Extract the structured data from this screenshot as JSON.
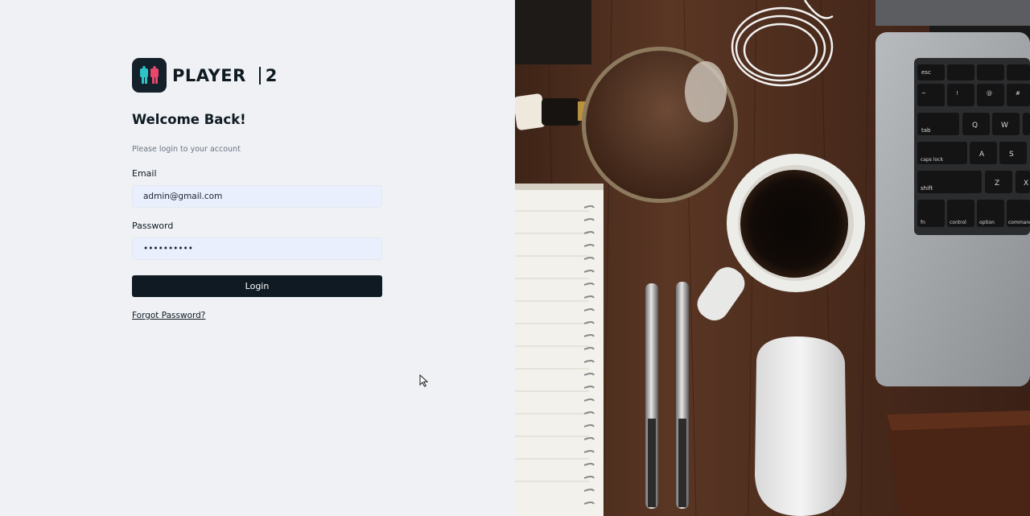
{
  "brand": {
    "name": "PLAYER",
    "number": "2",
    "accent_pink": "#e8476b",
    "accent_teal": "#2ec4c6",
    "dark": "#0f1a22"
  },
  "form": {
    "heading": "Welcome Back!",
    "subheading": "Please login to your account",
    "email_label": "Email",
    "email_value": "admin@gmail.com",
    "password_label": "Password",
    "password_value": "••••••••••",
    "login_button": "Login",
    "forgot_link": "Forgot Password?"
  },
  "colors": {
    "page_background": "#eff1f5",
    "input_background": "#e9effc",
    "button_background": "#0f1a22",
    "button_text": "#ffffff"
  },
  "hero": {
    "image_description_icon": "desk-photo",
    "keyboard_keys": [
      "esc",
      "~",
      "!",
      "@",
      "#",
      "tab",
      "Q",
      "W",
      "caps lock",
      "A",
      "S",
      "shift",
      "Z",
      "X",
      "fn",
      "control",
      "option",
      "command"
    ]
  }
}
